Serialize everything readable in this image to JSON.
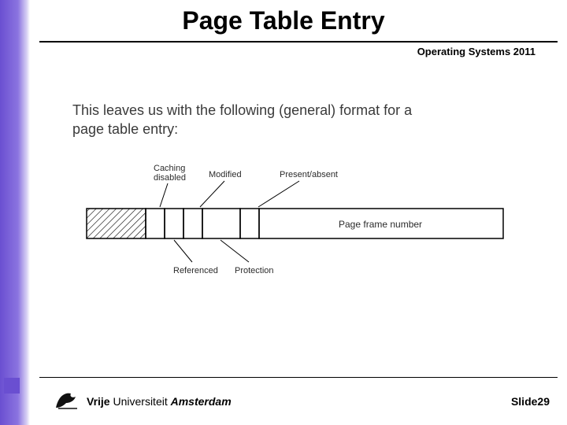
{
  "title": "Page Table Entry",
  "subtitle": "Operating Systems 2011",
  "body": {
    "line1": "This leaves us with the following (general) format for a",
    "line2": "page table entry:"
  },
  "figure": {
    "labels_top": {
      "caching_1": "Caching",
      "caching_2": "disabled",
      "modified": "Modified",
      "present": "Present/absent"
    },
    "labels_bottom": {
      "referenced": "Referenced",
      "protection": "Protection"
    },
    "frame_label": "Page frame number"
  },
  "footer": {
    "uni_1": "Vrije",
    "uni_2": "Universiteit",
    "uni_3": "Amsterdam",
    "slide_word": "Slide",
    "slide_num": "29"
  }
}
